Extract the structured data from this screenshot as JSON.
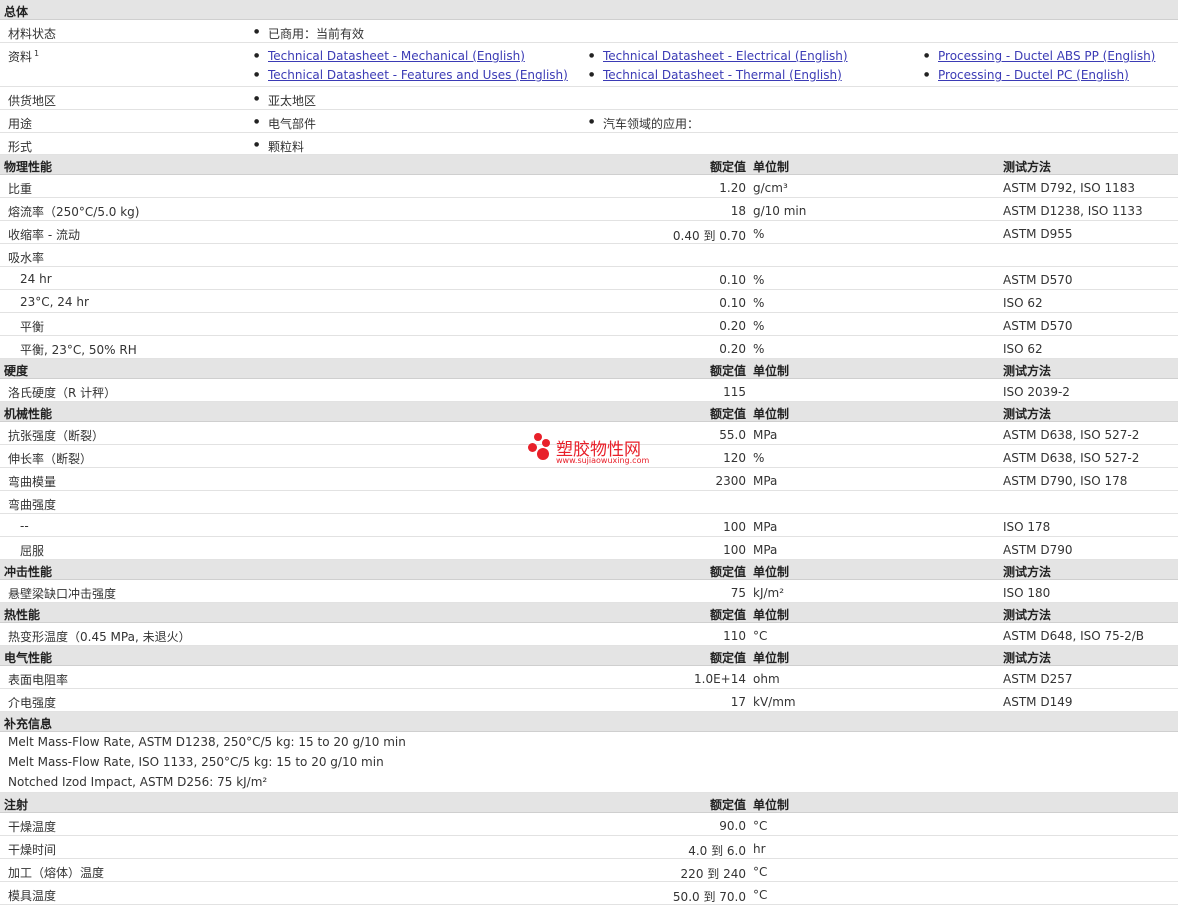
{
  "general": {
    "title": "总体",
    "status_label": "材料状态",
    "status_value": "已商用：当前有效",
    "docs_label": "资料",
    "docs_sup": "1",
    "docs": [
      "Technical Datasheet - Mechanical (English)",
      "Technical Datasheet - Electrical (English)",
      "Processing - Ductel ABS PP (English)",
      "Technical Datasheet - Features and Uses (English)",
      "Technical Datasheet - Thermal (English)",
      "Processing - Ductel PC (English)"
    ],
    "region_label": "供货地区",
    "region_value": "亚太地区",
    "use_label": "用途",
    "use_values": [
      "电气部件",
      "汽车领域的应用："
    ],
    "form_label": "形式",
    "form_value": "颗粒料"
  },
  "headers": {
    "value": "额定值",
    "unit": "单位制",
    "test": "测试方法"
  },
  "physical": {
    "title": "物理性能",
    "rows": [
      {
        "label": "比重",
        "value": "1.20",
        "unit": "g/cm³",
        "test": "ASTM D792, ISO 1183"
      },
      {
        "label": "熔流率（250°C/5.0 kg)",
        "value": "18",
        "unit": "g/10 min",
        "test": "ASTM D1238, ISO 1133"
      },
      {
        "label": "收缩率 - 流动",
        "value": "0.40 到  0.70",
        "unit": "%",
        "test": "ASTM D955"
      },
      {
        "label": "吸水率",
        "value": "",
        "unit": "",
        "test": ""
      },
      {
        "label": "24 hr",
        "value": "0.10",
        "unit": "%",
        "test": "ASTM D570"
      },
      {
        "label": "23°C, 24 hr",
        "value": "0.10",
        "unit": "%",
        "test": "ISO 62"
      },
      {
        "label": "平衡",
        "value": "0.20",
        "unit": "%",
        "test": "ASTM D570"
      },
      {
        "label": "平衡, 23°C, 50% RH",
        "value": "0.20",
        "unit": "%",
        "test": "ISO 62"
      }
    ]
  },
  "hardness": {
    "title": "硬度",
    "rows": [
      {
        "label": "洛氏硬度（R 计秤）",
        "value": "115",
        "unit": "",
        "test": "ISO 2039-2"
      }
    ]
  },
  "mechanical": {
    "title": "机械性能",
    "rows": [
      {
        "label": "抗张强度（断裂）",
        "value": "55.0",
        "unit": "MPa",
        "test": "ASTM D638, ISO 527-2"
      },
      {
        "label": "伸长率（断裂）",
        "value": "120",
        "unit": "%",
        "test": "ASTM D638, ISO 527-2"
      },
      {
        "label": "弯曲模量",
        "value": "2300",
        "unit": "MPa",
        "test": "ASTM D790, ISO 178"
      },
      {
        "label": "弯曲强度",
        "value": "",
        "unit": "",
        "test": ""
      },
      {
        "label": "--",
        "value": "100",
        "unit": "MPa",
        "test": "ISO 178"
      },
      {
        "label": "屈服",
        "value": "100",
        "unit": "MPa",
        "test": "ASTM D790"
      }
    ]
  },
  "impact": {
    "title": "冲击性能",
    "rows": [
      {
        "label": "悬壁梁缺口冲击强度",
        "value": "75",
        "unit": "kJ/m²",
        "test": "ISO 180"
      }
    ]
  },
  "thermal": {
    "title": "热性能",
    "rows": [
      {
        "label": "热变形温度（0.45 MPa, 未退火）",
        "value": "110",
        "unit": "°C",
        "test": "ASTM D648, ISO 75-2/B"
      }
    ]
  },
  "electrical": {
    "title": "电气性能",
    "rows": [
      {
        "label": "表面电阻率",
        "value": "1.0E+14",
        "unit": "ohm",
        "test": "ASTM D257"
      },
      {
        "label": "介电强度",
        "value": "17",
        "unit": "kV/mm",
        "test": "ASTM D149"
      }
    ]
  },
  "supplemental": {
    "title": "补充信息",
    "lines": [
      "Melt Mass-Flow Rate, ASTM D1238, 250°C/5 kg: 15 to 20 g/10 min",
      "Melt Mass-Flow Rate, ISO 1133, 250°C/5 kg: 15 to 20 g/10 min",
      "Notched Izod Impact, ASTM D256: 75 kJ/m²"
    ]
  },
  "injection": {
    "title": "注射",
    "rows": [
      {
        "label": "干燥温度",
        "value": "90.0",
        "unit": "°C"
      },
      {
        "label": "干燥时间",
        "value": "4.0 到  6.0",
        "unit": "hr"
      },
      {
        "label": "加工（熔体）温度",
        "value": "220 到  240",
        "unit": "°C"
      },
      {
        "label": "模具温度",
        "value": "50.0 到  70.0",
        "unit": "°C"
      }
    ]
  },
  "watermark": {
    "title": "塑胶物性网",
    "url": "www.sujiaowuxing.com"
  },
  "colors": {
    "section_bg": "#e4e4e4",
    "link": "#3b3bb5",
    "watermark": "#e8202a"
  }
}
